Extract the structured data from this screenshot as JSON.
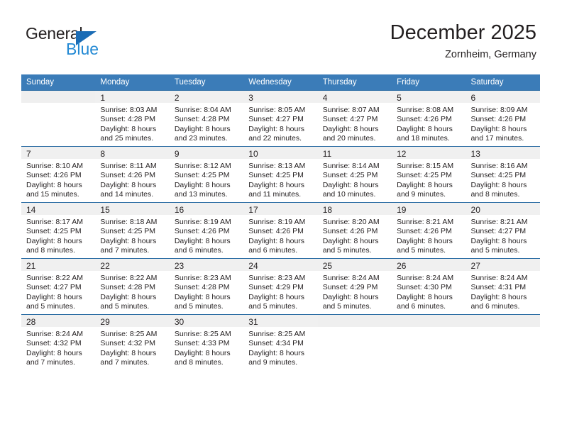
{
  "brand": {
    "name_top": "General",
    "name_bottom": "Blue",
    "color_blue": "#2389d4",
    "color_triangle": "#1b6cb5"
  },
  "header": {
    "title": "December 2025",
    "subtitle": "Zornheim, Germany"
  },
  "theme": {
    "header_bg": "#3b7cb8",
    "header_text": "#ffffff",
    "row_divider": "#2c6da4",
    "daynum_band": "#f0f0f0"
  },
  "calendar": {
    "weekday_headers": [
      "Sunday",
      "Monday",
      "Tuesday",
      "Wednesday",
      "Thursday",
      "Friday",
      "Saturday"
    ],
    "weeks": [
      [
        {
          "day": "",
          "sunrise": "",
          "sunset": "",
          "daylight1": "",
          "daylight2": ""
        },
        {
          "day": "1",
          "sunrise": "Sunrise: 8:03 AM",
          "sunset": "Sunset: 4:28 PM",
          "daylight1": "Daylight: 8 hours",
          "daylight2": "and 25 minutes."
        },
        {
          "day": "2",
          "sunrise": "Sunrise: 8:04 AM",
          "sunset": "Sunset: 4:28 PM",
          "daylight1": "Daylight: 8 hours",
          "daylight2": "and 23 minutes."
        },
        {
          "day": "3",
          "sunrise": "Sunrise: 8:05 AM",
          "sunset": "Sunset: 4:27 PM",
          "daylight1": "Daylight: 8 hours",
          "daylight2": "and 22 minutes."
        },
        {
          "day": "4",
          "sunrise": "Sunrise: 8:07 AM",
          "sunset": "Sunset: 4:27 PM",
          "daylight1": "Daylight: 8 hours",
          "daylight2": "and 20 minutes."
        },
        {
          "day": "5",
          "sunrise": "Sunrise: 8:08 AM",
          "sunset": "Sunset: 4:26 PM",
          "daylight1": "Daylight: 8 hours",
          "daylight2": "and 18 minutes."
        },
        {
          "day": "6",
          "sunrise": "Sunrise: 8:09 AM",
          "sunset": "Sunset: 4:26 PM",
          "daylight1": "Daylight: 8 hours",
          "daylight2": "and 17 minutes."
        }
      ],
      [
        {
          "day": "7",
          "sunrise": "Sunrise: 8:10 AM",
          "sunset": "Sunset: 4:26 PM",
          "daylight1": "Daylight: 8 hours",
          "daylight2": "and 15 minutes."
        },
        {
          "day": "8",
          "sunrise": "Sunrise: 8:11 AM",
          "sunset": "Sunset: 4:26 PM",
          "daylight1": "Daylight: 8 hours",
          "daylight2": "and 14 minutes."
        },
        {
          "day": "9",
          "sunrise": "Sunrise: 8:12 AM",
          "sunset": "Sunset: 4:25 PM",
          "daylight1": "Daylight: 8 hours",
          "daylight2": "and 13 minutes."
        },
        {
          "day": "10",
          "sunrise": "Sunrise: 8:13 AM",
          "sunset": "Sunset: 4:25 PM",
          "daylight1": "Daylight: 8 hours",
          "daylight2": "and 11 minutes."
        },
        {
          "day": "11",
          "sunrise": "Sunrise: 8:14 AM",
          "sunset": "Sunset: 4:25 PM",
          "daylight1": "Daylight: 8 hours",
          "daylight2": "and 10 minutes."
        },
        {
          "day": "12",
          "sunrise": "Sunrise: 8:15 AM",
          "sunset": "Sunset: 4:25 PM",
          "daylight1": "Daylight: 8 hours",
          "daylight2": "and 9 minutes."
        },
        {
          "day": "13",
          "sunrise": "Sunrise: 8:16 AM",
          "sunset": "Sunset: 4:25 PM",
          "daylight1": "Daylight: 8 hours",
          "daylight2": "and 8 minutes."
        }
      ],
      [
        {
          "day": "14",
          "sunrise": "Sunrise: 8:17 AM",
          "sunset": "Sunset: 4:25 PM",
          "daylight1": "Daylight: 8 hours",
          "daylight2": "and 8 minutes."
        },
        {
          "day": "15",
          "sunrise": "Sunrise: 8:18 AM",
          "sunset": "Sunset: 4:25 PM",
          "daylight1": "Daylight: 8 hours",
          "daylight2": "and 7 minutes."
        },
        {
          "day": "16",
          "sunrise": "Sunrise: 8:19 AM",
          "sunset": "Sunset: 4:26 PM",
          "daylight1": "Daylight: 8 hours",
          "daylight2": "and 6 minutes."
        },
        {
          "day": "17",
          "sunrise": "Sunrise: 8:19 AM",
          "sunset": "Sunset: 4:26 PM",
          "daylight1": "Daylight: 8 hours",
          "daylight2": "and 6 minutes."
        },
        {
          "day": "18",
          "sunrise": "Sunrise: 8:20 AM",
          "sunset": "Sunset: 4:26 PM",
          "daylight1": "Daylight: 8 hours",
          "daylight2": "and 5 minutes."
        },
        {
          "day": "19",
          "sunrise": "Sunrise: 8:21 AM",
          "sunset": "Sunset: 4:26 PM",
          "daylight1": "Daylight: 8 hours",
          "daylight2": "and 5 minutes."
        },
        {
          "day": "20",
          "sunrise": "Sunrise: 8:21 AM",
          "sunset": "Sunset: 4:27 PM",
          "daylight1": "Daylight: 8 hours",
          "daylight2": "and 5 minutes."
        }
      ],
      [
        {
          "day": "21",
          "sunrise": "Sunrise: 8:22 AM",
          "sunset": "Sunset: 4:27 PM",
          "daylight1": "Daylight: 8 hours",
          "daylight2": "and 5 minutes."
        },
        {
          "day": "22",
          "sunrise": "Sunrise: 8:22 AM",
          "sunset": "Sunset: 4:28 PM",
          "daylight1": "Daylight: 8 hours",
          "daylight2": "and 5 minutes."
        },
        {
          "day": "23",
          "sunrise": "Sunrise: 8:23 AM",
          "sunset": "Sunset: 4:28 PM",
          "daylight1": "Daylight: 8 hours",
          "daylight2": "and 5 minutes."
        },
        {
          "day": "24",
          "sunrise": "Sunrise: 8:23 AM",
          "sunset": "Sunset: 4:29 PM",
          "daylight1": "Daylight: 8 hours",
          "daylight2": "and 5 minutes."
        },
        {
          "day": "25",
          "sunrise": "Sunrise: 8:24 AM",
          "sunset": "Sunset: 4:29 PM",
          "daylight1": "Daylight: 8 hours",
          "daylight2": "and 5 minutes."
        },
        {
          "day": "26",
          "sunrise": "Sunrise: 8:24 AM",
          "sunset": "Sunset: 4:30 PM",
          "daylight1": "Daylight: 8 hours",
          "daylight2": "and 6 minutes."
        },
        {
          "day": "27",
          "sunrise": "Sunrise: 8:24 AM",
          "sunset": "Sunset: 4:31 PM",
          "daylight1": "Daylight: 8 hours",
          "daylight2": "and 6 minutes."
        }
      ],
      [
        {
          "day": "28",
          "sunrise": "Sunrise: 8:24 AM",
          "sunset": "Sunset: 4:32 PM",
          "daylight1": "Daylight: 8 hours",
          "daylight2": "and 7 minutes."
        },
        {
          "day": "29",
          "sunrise": "Sunrise: 8:25 AM",
          "sunset": "Sunset: 4:32 PM",
          "daylight1": "Daylight: 8 hours",
          "daylight2": "and 7 minutes."
        },
        {
          "day": "30",
          "sunrise": "Sunrise: 8:25 AM",
          "sunset": "Sunset: 4:33 PM",
          "daylight1": "Daylight: 8 hours",
          "daylight2": "and 8 minutes."
        },
        {
          "day": "31",
          "sunrise": "Sunrise: 8:25 AM",
          "sunset": "Sunset: 4:34 PM",
          "daylight1": "Daylight: 8 hours",
          "daylight2": "and 9 minutes."
        },
        {
          "day": "",
          "sunrise": "",
          "sunset": "",
          "daylight1": "",
          "daylight2": ""
        },
        {
          "day": "",
          "sunrise": "",
          "sunset": "",
          "daylight1": "",
          "daylight2": ""
        },
        {
          "day": "",
          "sunrise": "",
          "sunset": "",
          "daylight1": "",
          "daylight2": ""
        }
      ]
    ]
  }
}
